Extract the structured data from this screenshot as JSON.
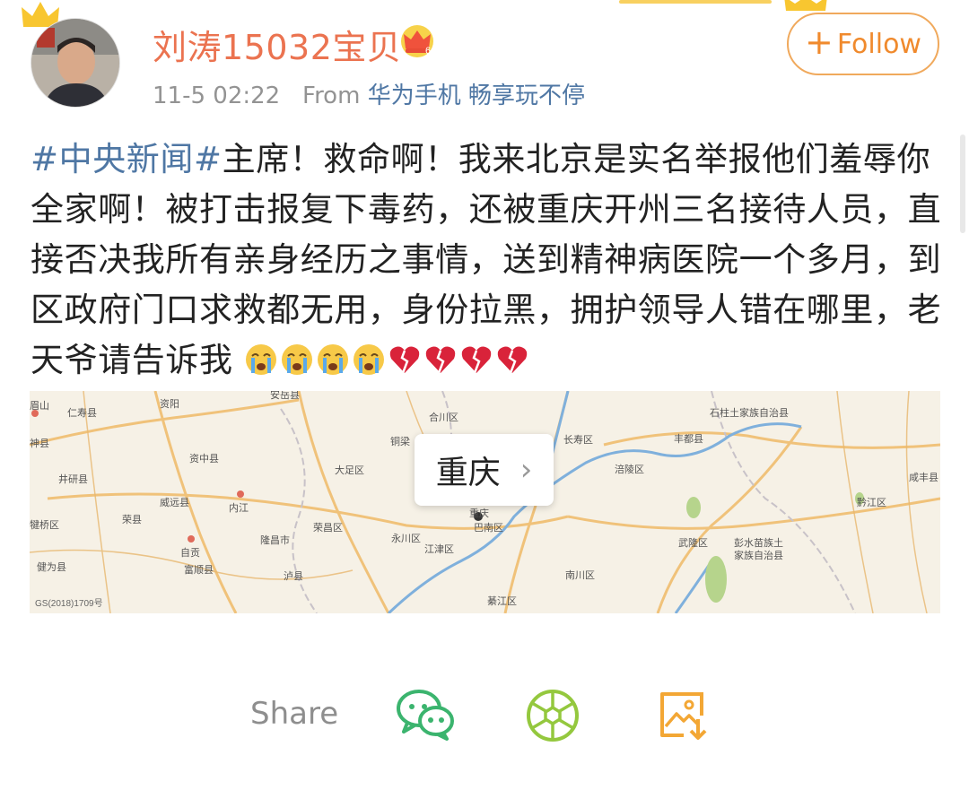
{
  "user": {
    "name": "刘涛15032宝贝",
    "time": "11-5 02:22",
    "from_label": "From",
    "source": "华为手机 畅享玩不停"
  },
  "follow_button": {
    "plus": "+",
    "label": "Follow"
  },
  "post": {
    "hashtag": "#中央新闻#",
    "text": "主席！救命啊！我来北京是实名举报他们羞辱你全家啊！被打击报复下毒药，还被重庆开州三名接待人员，直接否决我所有亲身经历之事情，送到精神病医院一个多月，到区政府门口求救都无用，身份拉黑，拥护领导人错在哪里，老天爷请告诉我",
    "emojis": [
      "crying-face",
      "crying-face",
      "crying-face",
      "crying-face",
      "broken-heart",
      "broken-heart",
      "broken-heart",
      "broken-heart"
    ]
  },
  "map": {
    "location_label": "重庆",
    "chevron": "›",
    "place_names": [
      "资阳",
      "安岳县",
      "仁寿县",
      "眉山",
      "神县",
      "井研县",
      "资中县",
      "大足区",
      "合川区",
      "铜梁",
      "长寿区",
      "丰都县",
      "石柱土家族自治县",
      "涪陵区",
      "咸丰县",
      "黔江区",
      "内江",
      "威远县",
      "荣县",
      "自贡",
      "隆昌市",
      "荣昌区",
      "永川区",
      "江津区",
      "巴南区",
      "重庆",
      "南川区",
      "武隆区",
      "彭水苗族土家族自治县",
      "富顺县",
      "泸县",
      "健为县",
      "綦江区",
      "犍为县"
    ],
    "credit": "GS(2018)1709号"
  },
  "share": {
    "label": "Share",
    "icons": [
      "wechat-icon",
      "moments-icon",
      "save-image-icon"
    ]
  },
  "colors": {
    "username": "#eb7350",
    "link": "#4f77a4",
    "follow": "#f08a2d",
    "wechat": "#3bb46e",
    "moments": "#94c83e",
    "save": "#f3a735"
  }
}
